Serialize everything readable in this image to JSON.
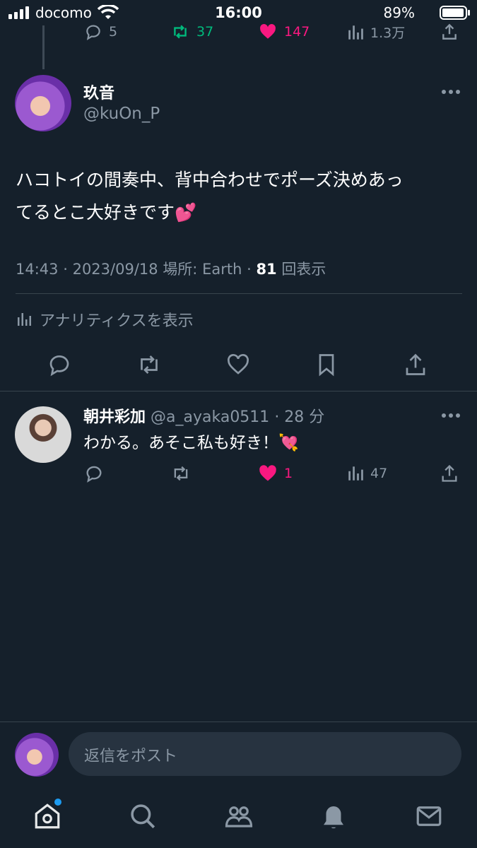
{
  "status_bar": {
    "carrier": "docomo",
    "time": "16:00",
    "battery": "89%"
  },
  "parent_actions": {
    "replies": "5",
    "retweets": "37",
    "likes": "147",
    "views": "1.3万"
  },
  "tweet": {
    "display_name": "玖音",
    "handle": "@kuOn_P",
    "text_line1": "ハコトイの間奏中、背中合わせでポーズ決めあっ",
    "text_line2": "てるとこ大好きです💕",
    "time": "14:43",
    "date": "2023/09/18",
    "location": "場所: Earth",
    "views_count": "81",
    "views_label": "回表示",
    "analytics_label": "アナリティクスを表示"
  },
  "reply": {
    "display_name": "朝井彩加",
    "handle": "@a_ayaka0511",
    "age": "· 28 分",
    "text": "わかる。あそこ私も好き！💘",
    "likes": "1",
    "views": "47"
  },
  "composer": {
    "placeholder": "返信をポスト"
  },
  "colors": {
    "background": "#15202b",
    "like": "#f91880",
    "retweet": "#00ba7c",
    "accent": "#1d9bf0"
  }
}
